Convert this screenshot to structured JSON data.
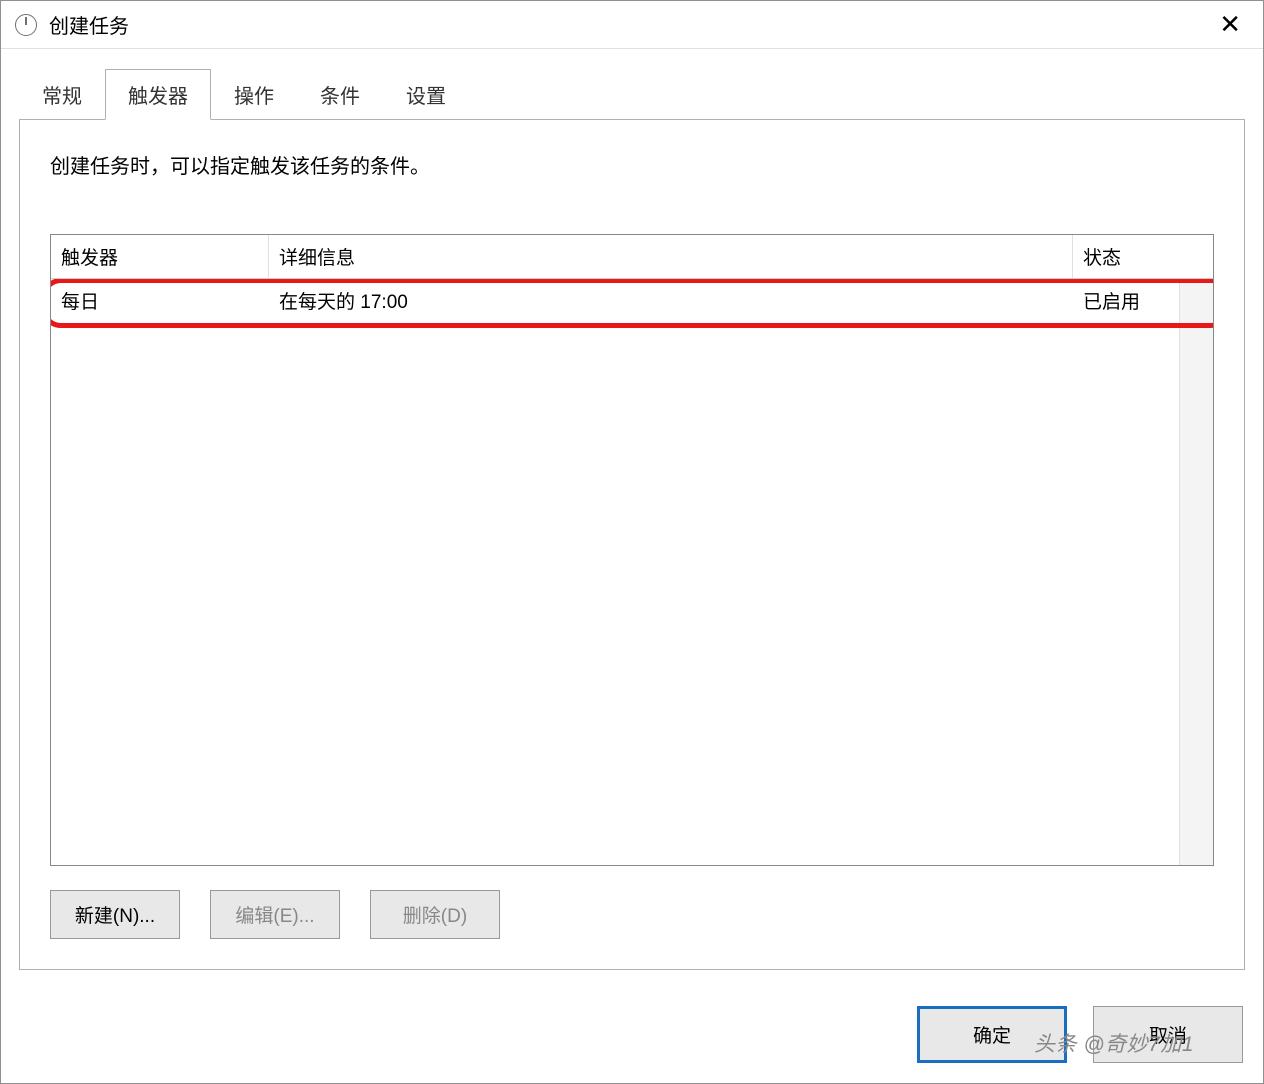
{
  "window": {
    "title": "创建任务"
  },
  "tabs": {
    "items": [
      {
        "label": "常规"
      },
      {
        "label": "触发器"
      },
      {
        "label": "操作"
      },
      {
        "label": "条件"
      },
      {
        "label": "设置"
      }
    ],
    "active_index": 1
  },
  "panel": {
    "description": "创建任务时，可以指定触发该任务的条件。"
  },
  "table": {
    "headers": {
      "trigger": "触发器",
      "detail": "详细信息",
      "status": "状态"
    },
    "rows": [
      {
        "trigger": "每日",
        "detail": "在每天的 17:00",
        "status": "已启用"
      }
    ]
  },
  "buttons": {
    "new": "新建(N)...",
    "edit": "编辑(E)...",
    "delete": "删除(D)"
  },
  "footer": {
    "ok": "确定",
    "cancel": "取消"
  },
  "watermark": "头条 @奇妙7加1"
}
